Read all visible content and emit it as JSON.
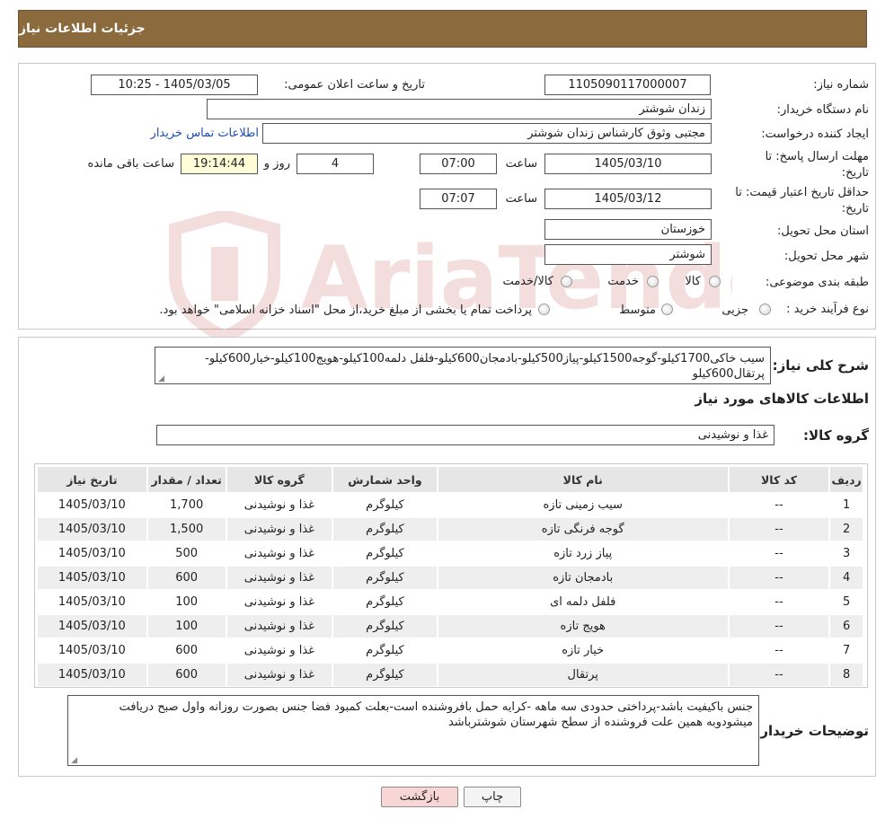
{
  "header": {
    "title": "جزئیات اطلاعات نیاز"
  },
  "form": {
    "need_number_label": "شماره نیاز:",
    "need_number": "1105090117000007",
    "announce_label": "تاریخ و ساعت اعلان عمومی:",
    "announce_value": "1405/03/05 - 10:25",
    "buyer_org_label": "نام دستگاه خریدار:",
    "buyer_org": "زندان شوشتر",
    "creator_label": "ایجاد کننده درخواست:",
    "creator": "مجتبی وثوق کارشناس زندان شوشتر",
    "contact_link": "اطلاعات تماس خریدار",
    "reply_deadline_label_1": "مهلت ارسال پاسخ: تا",
    "reply_deadline_label_2": "تاریخ:",
    "reply_date": "1405/03/10",
    "time_label": "ساعت",
    "reply_time": "07:00",
    "days": "4",
    "days_label": "روز و",
    "remaining_time": "19:14:44",
    "remaining_label": "ساعت باقی مانده",
    "price_valid_label_1": "حداقل تاریخ اعتبار قیمت: تا",
    "price_valid_label_2": "تاریخ:",
    "price_valid_date": "1405/03/12",
    "price_valid_time_label": "ساعت",
    "price_valid_time": "07:07",
    "province_label": "استان محل تحویل:",
    "province": "خوزستان",
    "city_label": "شهر محل تحویل:",
    "city": "شوشتر",
    "category_label": "طبقه بندی موضوعی:",
    "category_options": [
      "کالا",
      "خدمت",
      "کالا/خدمت"
    ],
    "purchase_type_label": "نوع فرآیند خرید :",
    "purchase_options": [
      "جزیی",
      "متوسط"
    ],
    "purchase_note": "پرداخت تمام یا بخشی از مبلغ خرید،از محل \"اسناد خزانه اسلامی\" خواهد بود."
  },
  "summary": {
    "label": "شرح کلی نیاز:",
    "text": "سیب خاکی1700کیلو-گوجه1500کیلو-پیاز500کیلو-بادمجان600کیلو-فلفل دلمه100کیلو-هویج100کیلو-خیار600کیلو-پرتقال600کیلو"
  },
  "goods": {
    "section_title": "اطلاعات کالاهای مورد نیاز",
    "group_label": "گروه کالا:",
    "group_value": "غذا و نوشیدنی",
    "columns": [
      "ردیف",
      "کد کالا",
      "نام کالا",
      "واحد شمارش",
      "گروه کالا",
      "تعداد / مقدار",
      "تاریخ نیاز"
    ],
    "rows": [
      [
        "1",
        "--",
        "سیب زمینی تازه",
        "کیلوگرم",
        "غذا و نوشیدنی",
        "1,700",
        "1405/03/10"
      ],
      [
        "2",
        "--",
        "گوجه فرنگی تازه",
        "کیلوگرم",
        "غذا و نوشیدنی",
        "1,500",
        "1405/03/10"
      ],
      [
        "3",
        "--",
        "پیاز زرد تازه",
        "کیلوگرم",
        "غذا و نوشیدنی",
        "500",
        "1405/03/10"
      ],
      [
        "4",
        "--",
        "بادمجان تازه",
        "کیلوگرم",
        "غذا و نوشیدنی",
        "600",
        "1405/03/10"
      ],
      [
        "5",
        "--",
        "فلفل دلمه ای",
        "کیلوگرم",
        "غذا و نوشیدنی",
        "100",
        "1405/03/10"
      ],
      [
        "6",
        "--",
        "هویج تازه",
        "کیلوگرم",
        "غذا و نوشیدنی",
        "100",
        "1405/03/10"
      ],
      [
        "7",
        "--",
        "خیار تازه",
        "کیلوگرم",
        "غذا و نوشیدنی",
        "600",
        "1405/03/10"
      ],
      [
        "8",
        "--",
        "پرتقال",
        "کیلوگرم",
        "غذا و نوشیدنی",
        "600",
        "1405/03/10"
      ]
    ]
  },
  "buyer_notes": {
    "label": "توضیحات خریدار:",
    "text": "جنس باکیفیت باشد-پرداختی حدودی سه ماهه -کرایه حمل بافروشنده است-بعلت کمبود فضا جنس بصورت روزانه واول صبح دریافت میشودوبه همین علت فروشنده از سطح شهرستان شوشترباشد"
  },
  "buttons": {
    "print": "چاپ",
    "back": "بازگشت"
  },
  "watermark": {
    "text": "AriaTender.neT"
  },
  "colors": {
    "header_bg": "#8b6a3e",
    "back_button_bg": "#f8d6d6",
    "print_button_bg": "#f4f4f4",
    "link": "#1f4fb3"
  }
}
